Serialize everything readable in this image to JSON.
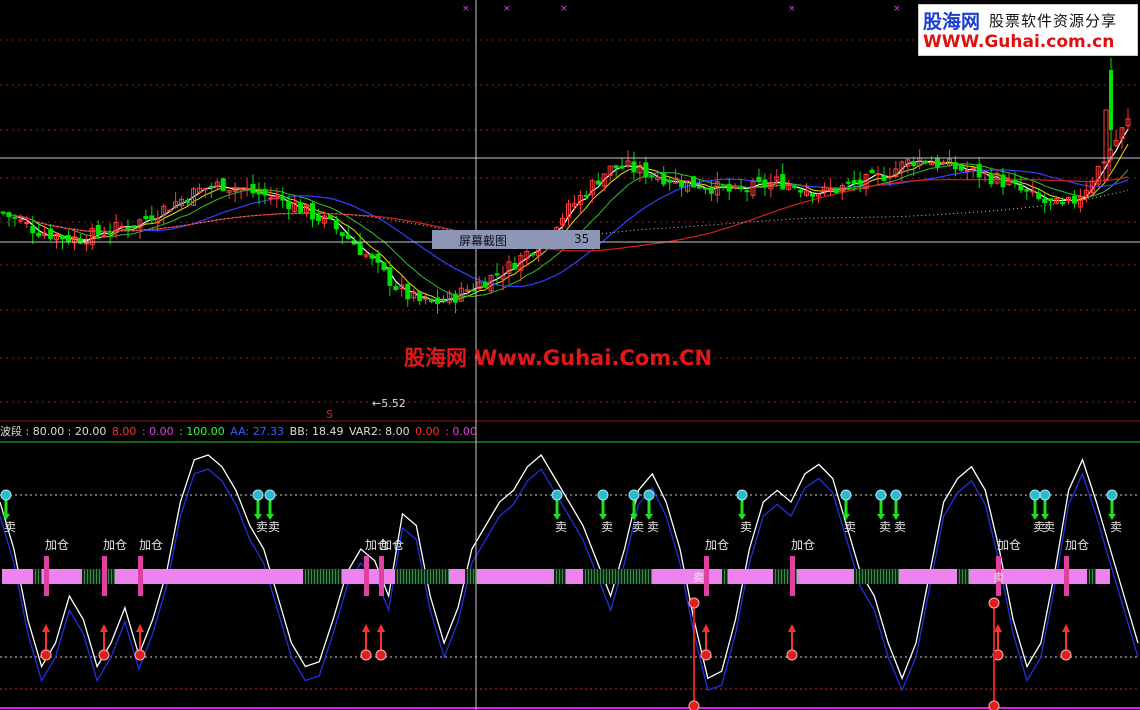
{
  "logo": {
    "name": "股海网",
    "slogan": "股票软件资源分享",
    "url": "WWW.Guhai.com.cn"
  },
  "watermark": "股海网 Www.Guhai.Com.CN",
  "tooltip": {
    "label": "屏幕截图",
    "value": "35"
  },
  "low_price_label": "5.52",
  "marker_s": "S",
  "indicator_bar": [
    {
      "text": "波段 : 80.00 : 20.00",
      "color": "#dcdcdc"
    },
    {
      "text": "8.00",
      "color": "#ff3030"
    },
    {
      "text": ": 0.00",
      "color": "#e040e0"
    },
    {
      "text": ": 100.00",
      "color": "#30ff30"
    },
    {
      "text": "AA: 27.33",
      "color": "#3060ff"
    },
    {
      "text": "BB: 18.49",
      "color": "#dcdcdc"
    },
    {
      "text": "VAR2: 8.00",
      "color": "#dcdcdc"
    },
    {
      "text": "0.00",
      "color": "#ff3030"
    },
    {
      "text": ": 0.00",
      "color": "#e040e0"
    }
  ],
  "signals": {
    "sell": "卖",
    "add": "加仓"
  },
  "colors": {
    "bg": "#000000",
    "up": "#ff3c3c",
    "down": "#00e000",
    "ma_white": "#ffffff",
    "ma_yellow": "#e8e000",
    "ma_green": "#30c030",
    "ma_blue": "#3040ff",
    "ma_red": "#d02020",
    "pink": "#ee82ee",
    "grid": "#8b1a1a",
    "crosshair": "#c8c8c8"
  },
  "chart_data": {
    "type": "candlestick",
    "price_low_marked": 5.52,
    "price_seed": [
      64,
      62,
      60,
      58,
      57,
      56,
      55,
      55,
      56,
      57,
      58,
      59,
      60,
      62,
      64,
      66,
      68,
      70,
      72,
      73,
      74,
      73,
      72,
      71,
      70,
      69,
      68,
      66,
      64,
      62,
      60,
      57,
      54,
      50,
      46,
      42,
      38,
      35,
      33,
      32,
      33,
      34,
      36,
      38,
      40,
      42,
      44,
      47,
      50,
      54,
      58,
      62,
      66,
      70,
      74,
      78,
      80,
      80,
      79,
      78,
      77,
      76,
      75,
      74,
      74,
      73,
      72,
      71,
      72,
      73,
      74,
      75,
      74,
      73,
      72,
      71,
      72,
      73,
      74,
      75,
      76,
      78,
      80,
      82,
      83,
      82,
      81,
      80,
      79,
      78,
      77,
      76,
      74,
      72,
      70,
      68,
      67,
      66,
      68,
      72,
      78,
      84,
      90,
      96
    ],
    "oscillator": [
      80,
      60,
      30,
      10,
      20,
      40,
      30,
      10,
      20,
      35,
      15,
      30,
      50,
      80,
      98,
      100,
      95,
      85,
      70,
      60,
      40,
      20,
      10,
      12,
      30,
      50,
      60,
      55,
      40,
      75,
      70,
      40,
      20,
      35,
      60,
      70,
      80,
      85,
      95,
      100,
      90,
      80,
      70,
      55,
      40,
      60,
      85,
      92,
      80,
      60,
      30,
      5,
      8,
      30,
      60,
      80,
      85,
      80,
      92,
      96,
      90,
      70,
      50,
      40,
      20,
      5,
      20,
      50,
      80,
      90,
      95,
      85,
      60,
      30,
      10,
      20,
      50,
      85,
      98,
      80,
      60,
      40,
      20
    ],
    "reference_lines": [
      80,
      20
    ]
  }
}
